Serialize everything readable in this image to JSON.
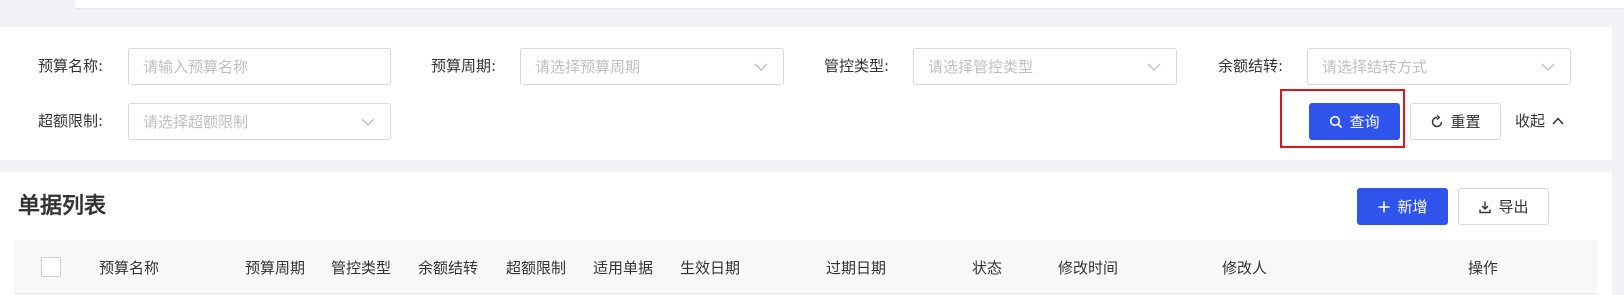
{
  "filters": {
    "budget_name": {
      "label": "预算名称:",
      "placeholder": "请输入预算名称"
    },
    "budget_period": {
      "label": "预算周期:",
      "placeholder": "请选择预算周期"
    },
    "control_type": {
      "label": "管控类型:",
      "placeholder": "请选择管控类型"
    },
    "balance_carryover": {
      "label": "余额结转:",
      "placeholder": "请选择结转方式"
    },
    "over_limit": {
      "label": "超额限制:",
      "placeholder": "请选择超额限制"
    }
  },
  "actions": {
    "query_label": "查询",
    "reset_label": "重置",
    "collapse_label": "收起"
  },
  "list": {
    "title": "单据列表",
    "add_label": "新增",
    "export_label": "导出",
    "columns": [
      "预算名称",
      "预算周期",
      "管控类型",
      "余额结转",
      "超额限制",
      "适用单据",
      "生效日期",
      "过期日期",
      "状态",
      "修改时间",
      "修改人",
      "操作"
    ]
  },
  "colors": {
    "primary": "#2f54eb",
    "highlight": "#e0151c"
  },
  "icons": {
    "query": "search-icon",
    "reset": "refresh-icon",
    "collapse": "chevron-up-icon",
    "add": "plus-icon",
    "export": "download-icon",
    "select": "chevron-down-icon"
  }
}
